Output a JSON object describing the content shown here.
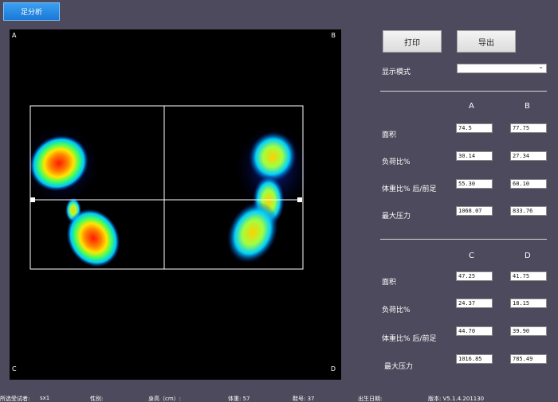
{
  "tab": {
    "label": "足分析"
  },
  "canvas": {
    "corners": {
      "a": "A",
      "b": "B",
      "c": "C",
      "d": "D"
    }
  },
  "buttons": {
    "print": "打印",
    "export": "导出"
  },
  "display_mode": {
    "label": "显示模式",
    "value": ""
  },
  "top_table": {
    "col_a": "A",
    "col_b": "B",
    "rows": [
      {
        "label": "面积",
        "a": "74.5",
        "b": "77.75"
      },
      {
        "label": "负荷比%",
        "a": "30.14",
        "b": "27.34"
      },
      {
        "label": "体重比% 后/前足",
        "a": "55.30",
        "b": "60.10"
      },
      {
        "label": "最大压力",
        "a": "1068.07",
        "b": "833.76"
      }
    ]
  },
  "bottom_table": {
    "col_c": "C",
    "col_d": "D",
    "rows": [
      {
        "label": "面积",
        "c": "47.25",
        "d": "41.75"
      },
      {
        "label": "负荷比%",
        "c": "24.37",
        "d": "18.15"
      },
      {
        "label": "体重比% 后/前足",
        "c": "44.70",
        "d": "39.90"
      },
      {
        "label": "最大压力",
        "c": "1016.85",
        "d": "785.49"
      }
    ]
  },
  "status_bar": {
    "subject": "所选受试者:",
    "subject_value": "sx1",
    "gender": "性别:",
    "height": "身高（cm）:",
    "weight": "体重: 57",
    "shoe": "鞋号: 37",
    "birth": "出生日期:",
    "version": "版本: V5.1.4.201130"
  },
  "colors": {
    "background": "#4c4a5c",
    "tab_accent": "#1a78d8",
    "canvas": "#000000"
  }
}
